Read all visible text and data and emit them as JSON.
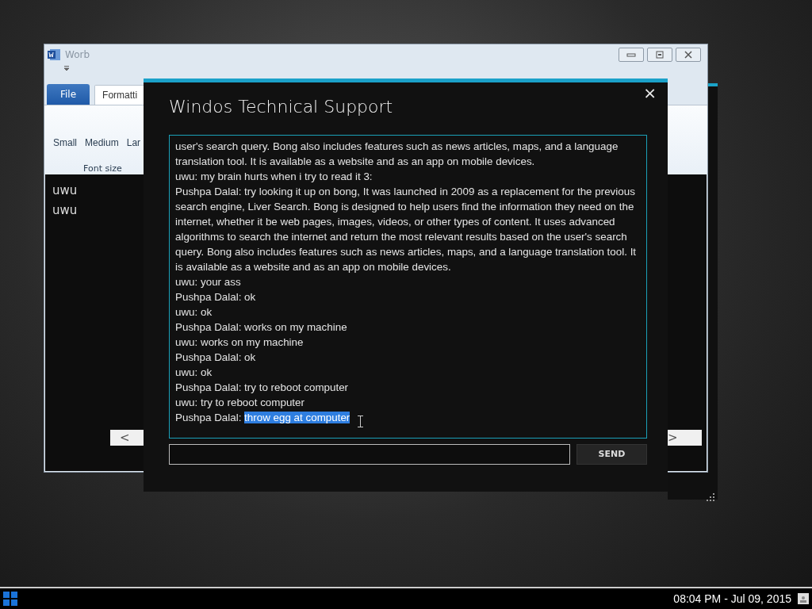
{
  "app_window": {
    "title": "Worb",
    "ribbon_tabs": [
      {
        "label": "File",
        "kind": "backstage",
        "selected": false
      },
      {
        "label": "Formatti",
        "kind": "tab",
        "selected": true
      }
    ],
    "ribbon_group": {
      "buttons": [
        "Small",
        "Medium",
        "Lar"
      ],
      "label": "Font size"
    },
    "document_lines": [
      "uwu",
      "uwu"
    ],
    "scroll_left": "<",
    "scroll_right": ">"
  },
  "dialog": {
    "title": "Windos Technical Support",
    "close": "×",
    "messages": [
      {
        "text": "user's search query. Bong also includes features such as news articles, maps, and a language translation tool. It is available as a website and as an app on mobile devices.",
        "selected": false
      },
      {
        "speaker": "uwu:",
        "text": "my brain hurts when i try to read it 3:",
        "selected": false
      },
      {
        "speaker": "Pushpa Dalal:",
        "text": "try looking it up on bong, It was launched in 2009 as a replacement for the previous search engine, Liver Search. Bong is designed to help users find the information they need on the internet, whether it be web pages, images, videos, or other types of content. It uses advanced algorithms to search the internet and return the most relevant results based on the user's search query. Bong also includes features such as news articles, maps, and a language translation tool. It is available as a website and as an app on mobile devices.",
        "selected": false
      },
      {
        "speaker": "uwu:",
        "text": "your ass",
        "selected": false
      },
      {
        "speaker": "Pushpa Dalal:",
        "text": "ok",
        "selected": false
      },
      {
        "speaker": "uwu:",
        "text": "ok",
        "selected": false
      },
      {
        "speaker": "Pushpa Dalal:",
        "text": "works on my machine",
        "selected": false
      },
      {
        "speaker": "uwu:",
        "text": "works on my machine",
        "selected": false
      },
      {
        "speaker": "Pushpa Dalal:",
        "text": "ok",
        "selected": false
      },
      {
        "speaker": "uwu:",
        "text": "ok",
        "selected": false
      },
      {
        "speaker": "Pushpa Dalal:",
        "text": "try to reboot computer",
        "selected": false
      },
      {
        "speaker": "uwu:",
        "text": "try to reboot computer",
        "selected": false
      },
      {
        "speaker": "Pushpa Dalal:",
        "text": "throw egg at computer",
        "selected": true
      }
    ],
    "send_button": "SEND"
  },
  "taskbar": {
    "clock": "08:04 PM - Jul 09, 2015"
  }
}
